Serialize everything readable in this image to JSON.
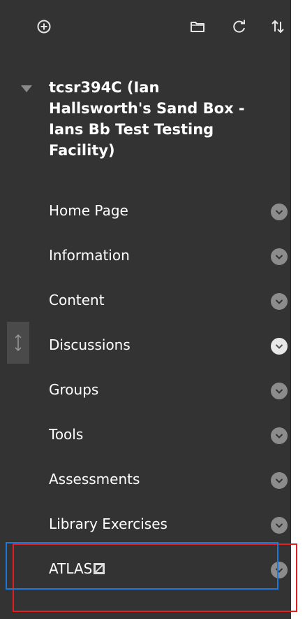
{
  "toolbar": {
    "icons": [
      "add-circle-icon",
      "folder-icon",
      "refresh-icon",
      "sort-icon"
    ]
  },
  "course": {
    "title": "tcsr394C (Ian Hallsworth's Sand Box - Ians Bb Test Testing Facility)",
    "expanded": true
  },
  "menu": {
    "items": [
      {
        "label": "Home Page",
        "highlighted": false
      },
      {
        "label": "Information",
        "highlighted": false
      },
      {
        "label": "Content",
        "highlighted": false
      },
      {
        "label": "Discussions",
        "highlighted": true
      },
      {
        "label": "Groups",
        "highlighted": false
      },
      {
        "label": "Tools",
        "highlighted": false
      },
      {
        "label": "Assessments",
        "highlighted": false
      },
      {
        "label": "Library Exercises",
        "highlighted": false
      },
      {
        "label": "ATLAS",
        "highlighted": false,
        "external": true
      }
    ]
  },
  "colors": {
    "panel_bg": "#333333",
    "text": "#ffffff",
    "chevron": "#8c8c8c",
    "chevron_bright": "#e8e8e8",
    "highlight_red": "#e02020",
    "highlight_blue": "#1e78d7"
  }
}
